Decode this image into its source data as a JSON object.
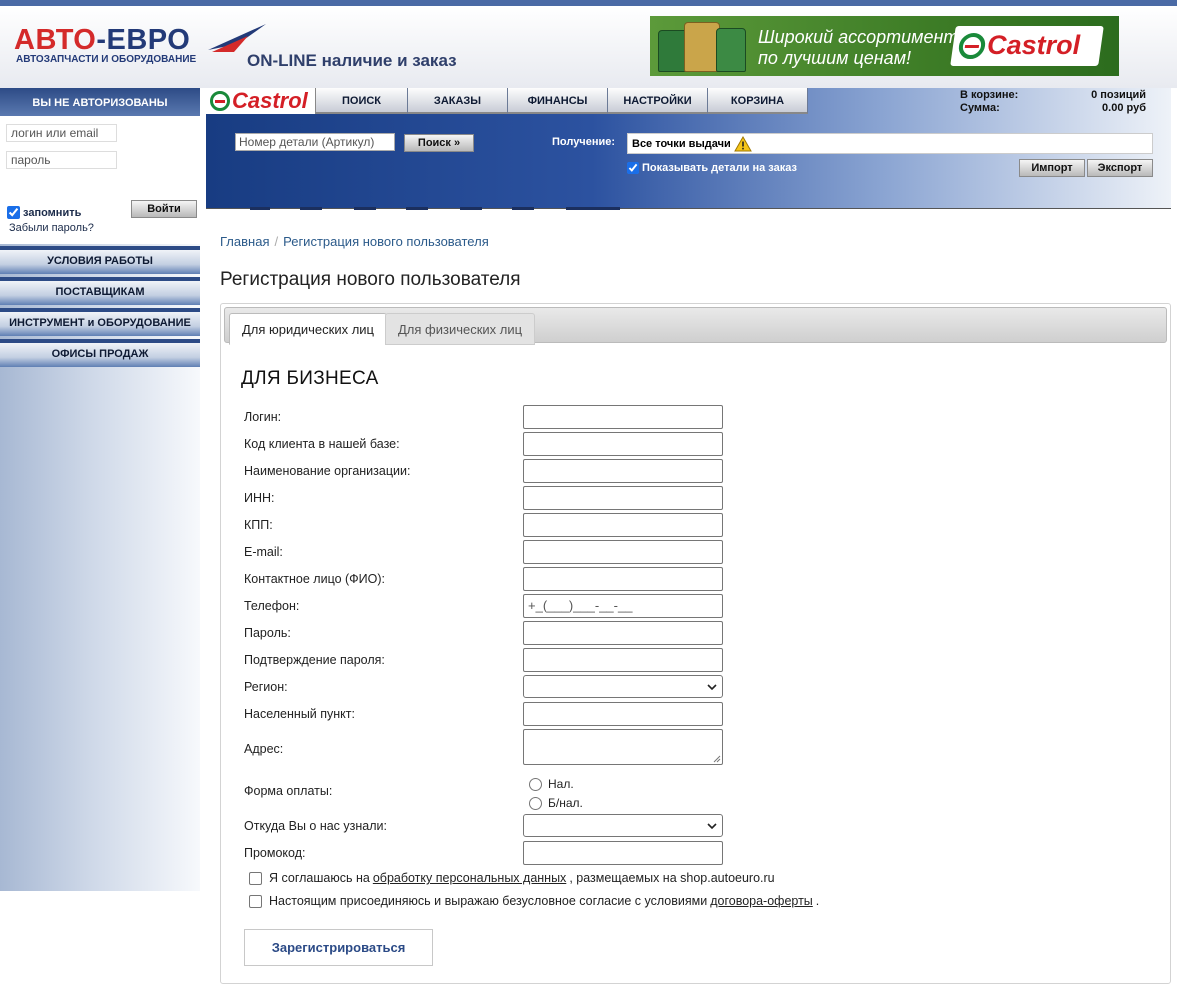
{
  "brand": {
    "name_red": "АВТО",
    "name_dash": "-",
    "name_navy": "ЕВРО",
    "subtitle": "АВТОЗАПЧАСТИ И ОБОРУДОВАНИЕ",
    "slogan": "ON-LINE наличие и заказ",
    "colors": {
      "red": "#d42a2a",
      "navy": "#233a78"
    }
  },
  "banner": {
    "line1": "Широкий ассортимент",
    "line2": "по лучшим ценам!",
    "logo_text": "Castrol"
  },
  "sidebar": {
    "auth_header": "ВЫ НЕ АВТОРИЗОВАНЫ",
    "login_placeholder": "логин или email",
    "password_placeholder": "пароль",
    "remember_label": "запомнить",
    "login_button": "Войти",
    "forgot_link": "Забыли пароль?",
    "menu": [
      {
        "label": "УСЛОВИЯ РАБОТЫ"
      },
      {
        "label": "ПОСТАВЩИКАМ"
      },
      {
        "label": "ИНСТРУМЕНТ и ОБОРУДОВАНИЕ"
      },
      {
        "label": "ОФИСЫ ПРОДАЖ"
      }
    ]
  },
  "nav": {
    "castrol": "Castrol",
    "tabs": [
      {
        "label": "ПОИСК"
      },
      {
        "label": "ЗАКАЗЫ"
      },
      {
        "label": "ФИНАНСЫ"
      },
      {
        "label": "НАСТРОЙКИ"
      },
      {
        "label": "КОРЗИНА"
      }
    ],
    "cart": {
      "items_label": "В корзине:",
      "items_value": "0 позиций",
      "sum_label": "Сумма:",
      "sum_value": "0.00 руб"
    },
    "search_placeholder": "Номер детали (Артикул)",
    "search_button": "Поиск »",
    "pickup_label": "Получение:",
    "pickup_value": "Все точки выдачи",
    "show_order_label": "Показывать детали на заказ",
    "import_button": "Импорт",
    "export_button": "Экспорт"
  },
  "breadcrumb": {
    "home": "Главная",
    "separator": "/",
    "current": "Регистрация нового пользователя"
  },
  "page_title": "Регистрация нового пользователя",
  "tabs": {
    "legal": "Для юридических лиц",
    "individual": "Для физических лиц"
  },
  "section_title": "ДЛЯ БИЗНЕСА",
  "form": {
    "login": "Логин:",
    "client_code": "Код клиента в нашей базе:",
    "org_name": "Наименование организации:",
    "inn": "ИНН:",
    "kpp": "КПП:",
    "email": "E-mail:",
    "contact": "Контактное лицо (ФИО):",
    "phone": "Телефон:",
    "phone_mask": "+_(___)___-__-__",
    "password": "Пароль:",
    "password_confirm": "Подтверждение пароля:",
    "region": "Регион:",
    "city": "Населенный пункт:",
    "address": "Адрес:",
    "payment": "Форма оплаты:",
    "payment_cash": "Нал.",
    "payment_cashless": "Б/нал.",
    "source": "Откуда Вы о нас узнали:",
    "promo": "Промокод:"
  },
  "agree": {
    "pd_before": "Я соглашаюсь на",
    "pd_link": "обработку персональных данных",
    "pd_after": ", размещаемых на shop.autoeuro.ru",
    "offer_before": "Настоящим присоединяюсь и выражаю безусловное согласие с условиями",
    "offer_link": "договора-оферты",
    "offer_after": "."
  },
  "submit_label": "Зарегистрироваться"
}
